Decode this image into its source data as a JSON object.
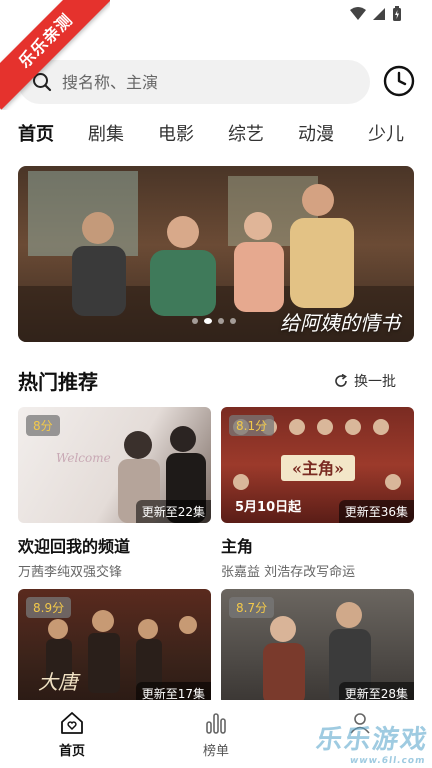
{
  "ribbon": {
    "text": "乐乐亲测"
  },
  "search": {
    "placeholder": "搜名称、主演"
  },
  "tabs": [
    "首页",
    "剧集",
    "电影",
    "综艺",
    "动漫",
    "少儿"
  ],
  "banner": {
    "title": "给阿姨的情书"
  },
  "section": {
    "title": "热门推荐",
    "refresh_label": "换一批"
  },
  "cards": [
    {
      "score": "8分",
      "update": "更新至22集",
      "title": "欢迎回我的频道",
      "subtitle": "万茜李纯双强交锋"
    },
    {
      "score": "8.1分",
      "update": "更新至36集",
      "title": "主角",
      "subtitle": "张嘉益 刘浩存改写命运"
    },
    {
      "score": "8.9分",
      "update": "更新至17集",
      "title": "",
      "subtitle": ""
    },
    {
      "score": "8.7分",
      "update": "更新至28集",
      "title": "",
      "subtitle": ""
    }
  ],
  "nav": [
    {
      "label": "首页",
      "icon": "home-icon"
    },
    {
      "label": "榜单",
      "icon": "chart-icon"
    },
    {
      "label": "",
      "icon": "user-icon"
    }
  ],
  "watermark": {
    "text": "乐乐游戏",
    "url": "www.6ll.com"
  }
}
